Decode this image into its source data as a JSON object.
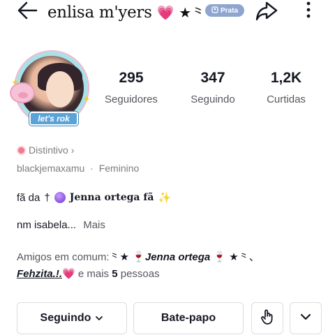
{
  "header": {
    "username": "enlisa m'yers",
    "heart": "💗",
    "star": "★",
    "lines": "⺀",
    "badge_label": "Prata"
  },
  "avatar": {
    "label": "let's rok"
  },
  "stats": [
    {
      "value": "295",
      "label": "Seguidores"
    },
    {
      "value": "347",
      "label": "Seguindo"
    },
    {
      "value": "1,2K",
      "label": "Curtidas"
    }
  ],
  "profile": {
    "distintivo": "Distintivo",
    "handle": "blackjemaxamu",
    "separator": "·",
    "gender": "Feminino"
  },
  "bio": {
    "line1_prefix": "fã da",
    "cross": "†",
    "line1_name": "Jenna ortega fã",
    "sparkle": "✨",
    "line2": "nm isabela...",
    "more": "Mais"
  },
  "friends": {
    "prefix": "Amigos em comum:",
    "deco_left": "⺀★",
    "wine": "🍷",
    "name1": "Jenna ortega",
    "deco_right": "★⺀、",
    "name2": "Fehzita.!.",
    "heart": "💗",
    "and_more": "e mais",
    "count": "5",
    "people": "pessoas"
  },
  "actions": {
    "following": "Seguindo",
    "chat": "Bate-papo"
  }
}
